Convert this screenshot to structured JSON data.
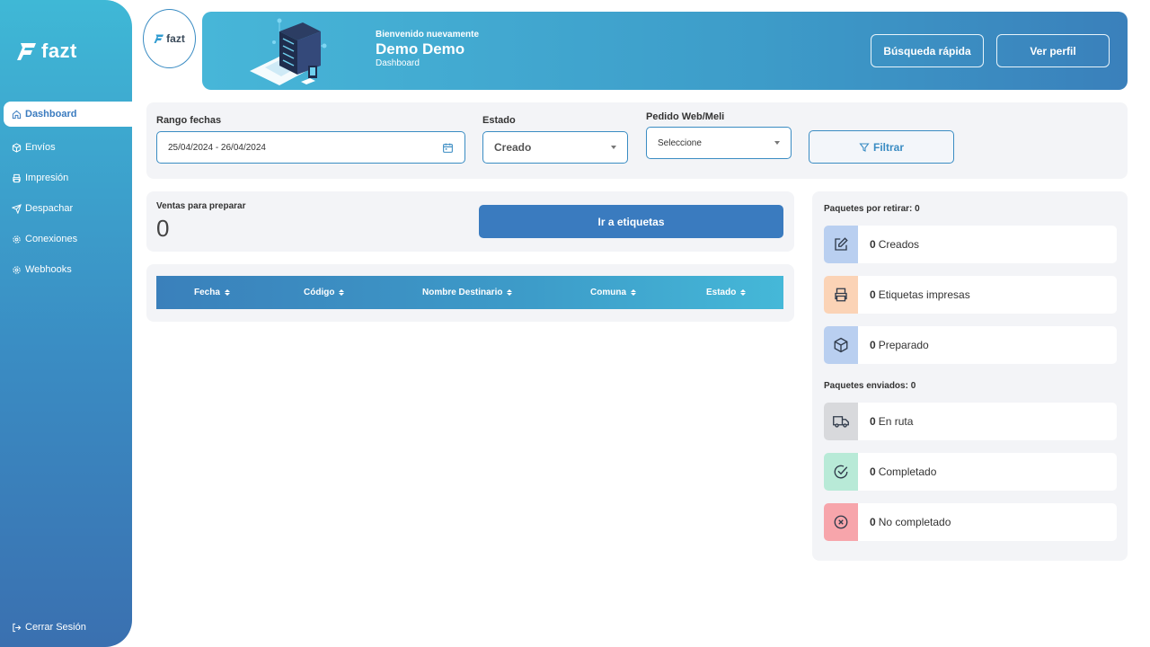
{
  "sidebar": {
    "logo": "fazt",
    "items": [
      {
        "label": "Dashboard",
        "icon": "home-icon",
        "active": true
      },
      {
        "label": "Envíos",
        "icon": "box-icon"
      },
      {
        "label": "Impresión",
        "icon": "printer-icon"
      },
      {
        "label": "Despachar",
        "icon": "send-icon"
      },
      {
        "label": "Conexiones",
        "icon": "gear-icon"
      },
      {
        "label": "Webhooks",
        "icon": "gear-icon"
      }
    ],
    "logout": "Cerrar Sesión"
  },
  "header": {
    "brand_mini": "fazt",
    "welcome": "Bienvenido nuevamente",
    "user": "Demo Demo",
    "page": "Dashboard",
    "quick_search": "Búsqueda rápida",
    "profile": "Ver perfil"
  },
  "filters": {
    "date_label": "Rango fechas",
    "date_value": "25/04/2024 - 26/04/2024",
    "state_label": "Estado",
    "state_value": "Creado",
    "order_label": "Pedido Web/Meli",
    "order_value": "Seleccione",
    "filter_button": "Filtrar"
  },
  "sales": {
    "label": "Ventas para preparar",
    "count": "0",
    "button": "Ir a etiquetas"
  },
  "table": {
    "columns": [
      "Fecha",
      "Código",
      "Nombre Destinario",
      "Comuna",
      "Estado"
    ]
  },
  "status": {
    "pickup_title": "Paquetes por retirar: 0",
    "pickup": [
      {
        "count": "0",
        "label": "Creados",
        "icon": "edit-icon",
        "bg": "#b9cff0"
      },
      {
        "count": "0",
        "label": "Etiquetas impresas",
        "icon": "printer-icon",
        "bg": "#fbd3b6"
      },
      {
        "count": "0",
        "label": "Preparado",
        "icon": "box-icon",
        "bg": "#b9cff0"
      }
    ],
    "sent_title": "Paquetes enviados: 0",
    "sent": [
      {
        "count": "0",
        "label": "En ruta",
        "icon": "truck-icon",
        "bg": "#d8d9dc"
      },
      {
        "count": "0",
        "label": "Completado",
        "icon": "check-circle-icon",
        "bg": "#b8ead7"
      },
      {
        "count": "0",
        "label": "No completado",
        "icon": "x-circle-icon",
        "bg": "#f7a5ab"
      }
    ]
  }
}
